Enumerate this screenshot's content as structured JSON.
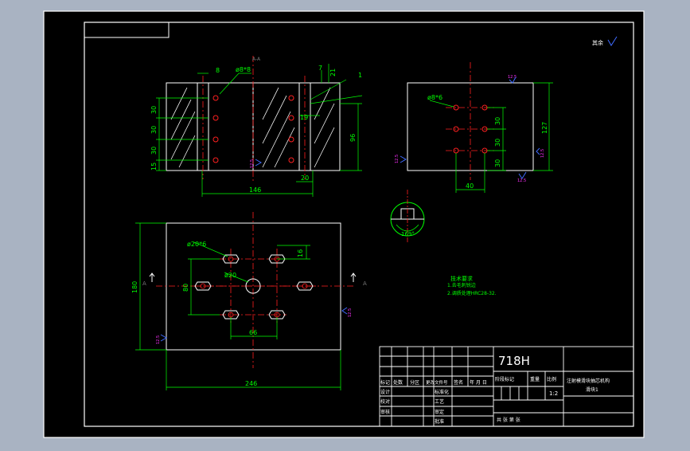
{
  "colors": {
    "background": "#a9b3c2",
    "sheet": "#000000",
    "outline": "#ffffff",
    "dimension": "#00ff00",
    "centerline": "#ff2020",
    "roughness": "#3f6bff",
    "roughness_value": "#ff30ff",
    "title_text": "#ffffff"
  },
  "front_view": {
    "section_label": "A-A",
    "dims": {
      "top_8": "8",
      "hole_note": "ø8*8",
      "top_7": "7",
      "top_21": "21",
      "left_30a": "30",
      "left_30b": "30",
      "left_30c": "30",
      "left_15": "15",
      "right_96": "96",
      "mid_19": "19",
      "bottom_146": "146",
      "bottom_20": "20",
      "roughness": "12.5"
    },
    "balloon": "1"
  },
  "side_view": {
    "dims": {
      "hole_note": "ø8*6",
      "v30a": "30",
      "v30b": "30",
      "v30c": "30",
      "h127": "127",
      "w40": "40"
    },
    "roughness": {
      "top": "12.5",
      "side": "12.5",
      "bottom": "12.5"
    }
  },
  "detail_view": {
    "angle": "169°"
  },
  "plan_view": {
    "dims": {
      "holes6": "ø20*6",
      "center_hole": "ø20",
      "h16": "16",
      "v80": "80",
      "w66": "66",
      "h180": "180",
      "w246": "246"
    },
    "section_marks": {
      "left": "A",
      "right": "A"
    },
    "roughness": {
      "left": "12.5",
      "right": "12.5"
    }
  },
  "notes": {
    "title": "技术要求",
    "lines": [
      "1.去毛刺锐边",
      "2.调质处理HRC28-32."
    ]
  },
  "title_block": {
    "material": "718H",
    "header_cols": [
      "标记",
      "处数",
      "分区",
      "更改文件号",
      "签名",
      "年 月 日"
    ],
    "row_design": [
      "设计",
      "标准化"
    ],
    "row_check": [
      "校对",
      "工艺"
    ],
    "row_review": [
      "审核",
      "审定"
    ],
    "row_approve": "批准",
    "stage_headers": [
      "阶段标记",
      "重量",
      "比例"
    ],
    "scale": "1:2",
    "part_name": [
      "注射模滑块抽芯机构",
      "滑块1"
    ],
    "sheet_info": "共 张 第 张",
    "roughness_mark": "其余"
  }
}
